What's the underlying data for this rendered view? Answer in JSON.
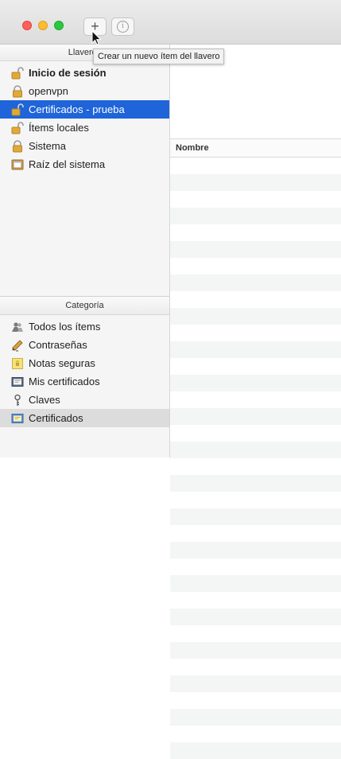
{
  "window": {
    "toolbar": {
      "add_glyph": "+",
      "info_glyph": "i"
    },
    "tooltip": "Crear un nuevo ítem del llavero"
  },
  "sidebar": {
    "keychains_header": "Llaveros",
    "keychains": [
      {
        "label": "Inicio de sesión",
        "icon": "lock-open-icon",
        "bold": true
      },
      {
        "label": "openvpn",
        "icon": "lock-closed-icon"
      },
      {
        "label": "Certificados - prueba",
        "icon": "lock-open-icon",
        "selected": true
      },
      {
        "label": "Ítems locales",
        "icon": "lock-open-icon"
      },
      {
        "label": "Sistema",
        "icon": "lock-closed-icon"
      },
      {
        "label": "Raíz del sistema",
        "icon": "cabinet-icon"
      }
    ],
    "category_header": "Categoría",
    "categories": [
      {
        "label": "Todos los ítems",
        "icon": "people-icon"
      },
      {
        "label": "Contraseñas",
        "icon": "pen-icon"
      },
      {
        "label": "Notas seguras",
        "icon": "secure-note-icon"
      },
      {
        "label": "Mis certificados",
        "icon": "my-certificate-icon"
      },
      {
        "label": "Claves",
        "icon": "key-icon"
      },
      {
        "label": "Certificados",
        "icon": "certificate-icon",
        "selected": true
      }
    ]
  },
  "main": {
    "column_name": "Nombre"
  },
  "colors": {
    "selection_blue": "#1f64d9",
    "selection_gray": "#dcdcdc",
    "lock_gold": "#e0a93a"
  }
}
